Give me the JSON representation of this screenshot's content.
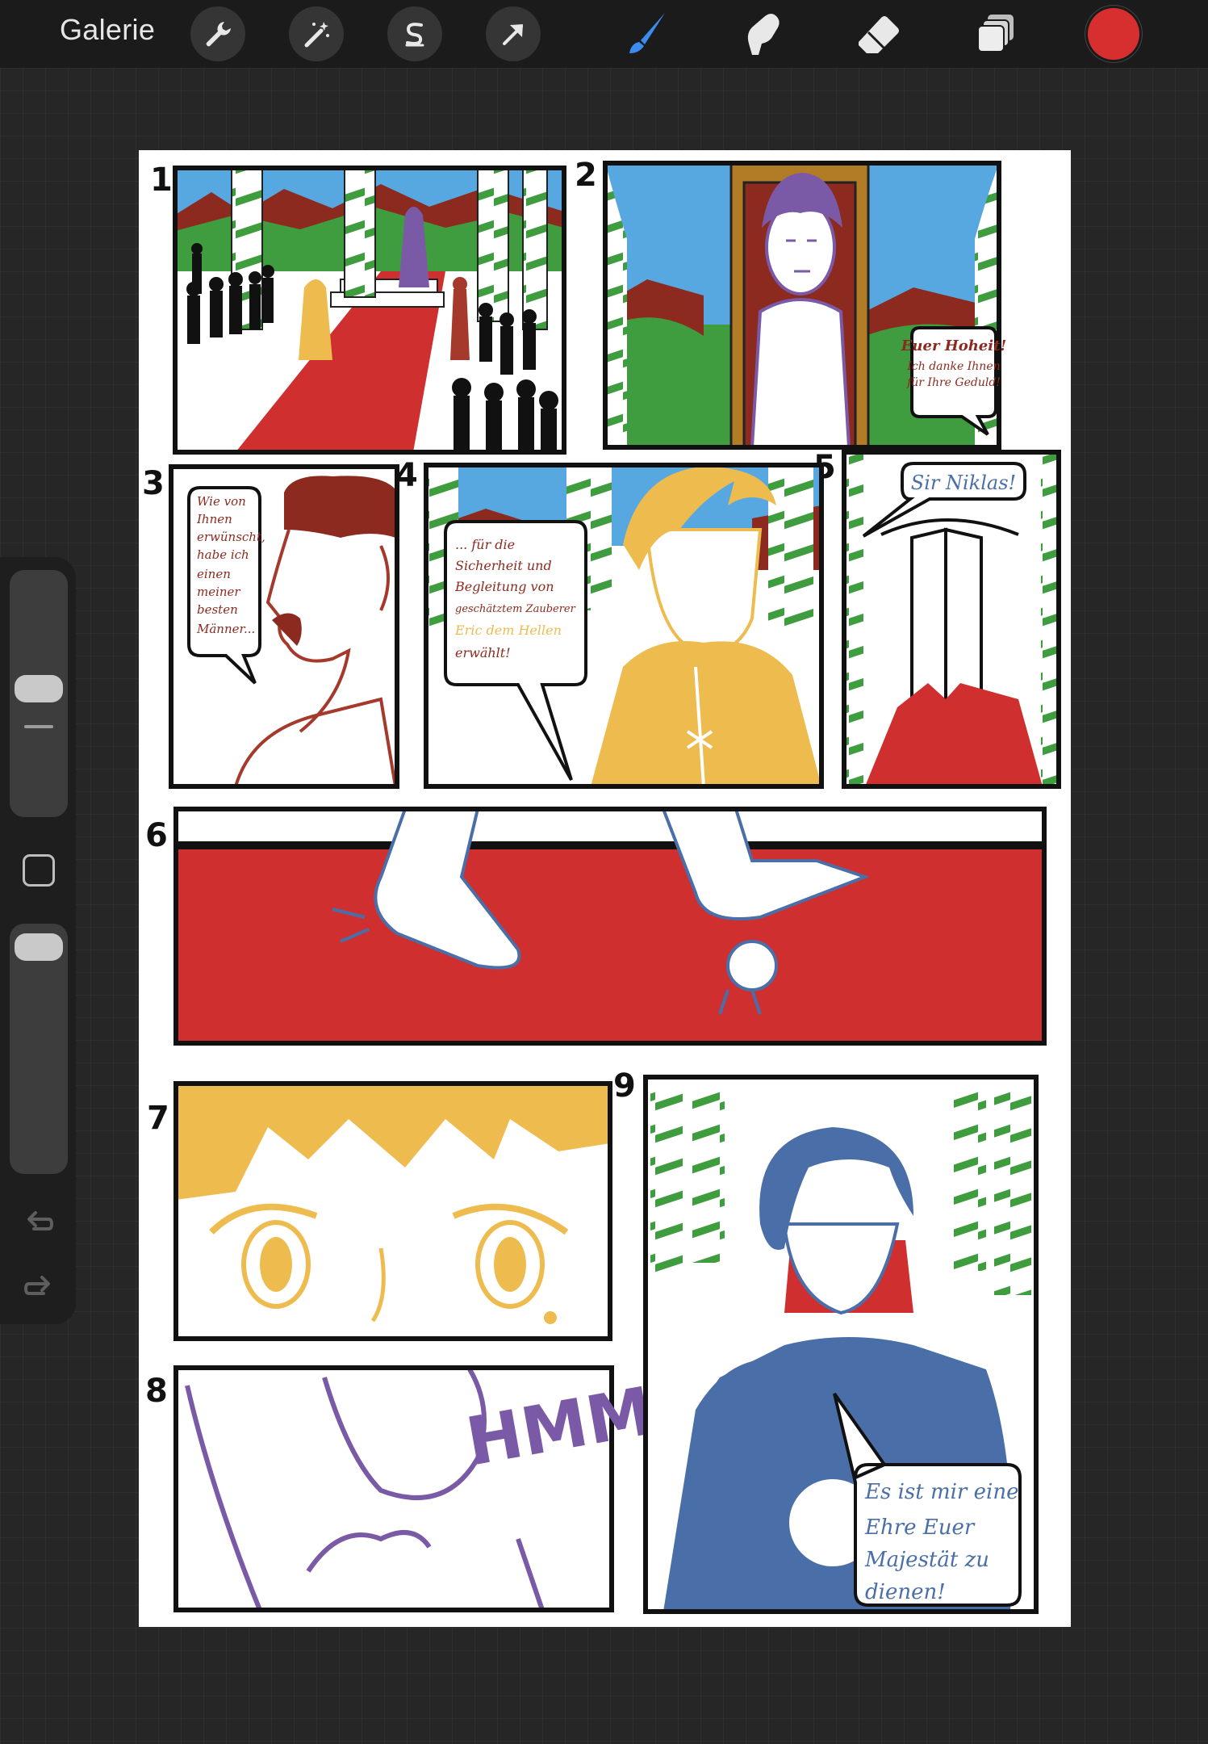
{
  "toolbar": {
    "gallery_label": "Galerie",
    "left_tools": [
      "wrench-icon",
      "magic-wand-icon",
      "selection-s-icon",
      "transform-arrow-icon"
    ],
    "right_tools": [
      "brush-icon",
      "smudge-icon",
      "eraser-icon",
      "layers-icon"
    ],
    "active_tool": "brush-icon",
    "active_color": "#d72f2f"
  },
  "sidebar": {
    "size_slider_level": 0.5,
    "opacity_slider_level": 0.95,
    "controls": [
      "modify-square-button",
      "undo-icon",
      "redo-icon"
    ]
  },
  "comic": {
    "panel_numbers": [
      "1",
      "2",
      "3",
      "4",
      "5",
      "6",
      "7",
      "8",
      "9"
    ],
    "panel2_bubble": [
      "Euer Hoheit!",
      "Ich danke Ihnen",
      "für Ihre Geduld!"
    ],
    "panel3_bubble": [
      "Wie von",
      "Ihnen",
      "erwünscht,",
      "habe ich",
      "einen",
      "meiner",
      "besten",
      "Männer..."
    ],
    "panel4_bubble": [
      "... für die",
      "Sicherheit und",
      "Begleitung von",
      "geschätztem Zauberer",
      "Eric dem Hellen",
      "erwählt!"
    ],
    "panel5_bubble": "Sir Niklas!",
    "panel8_sound": "HMM",
    "panel9_bubble": [
      "Es ist mir eine",
      "Ehre Euer",
      "Majestät zu",
      "dienen!"
    ],
    "colors": {
      "carpet_red": "#cf2f2f",
      "gold": "#eebb4f",
      "wall_green": "#3f9c3f",
      "sky_blue": "#57a8e0",
      "mountain_brown": "#8c2a1f",
      "knight_blue": "#4a6fa8",
      "queen_purple": "#7a5aa6",
      "advisor_red": "#a53a2c",
      "throne_brown": "#b27c26"
    }
  }
}
